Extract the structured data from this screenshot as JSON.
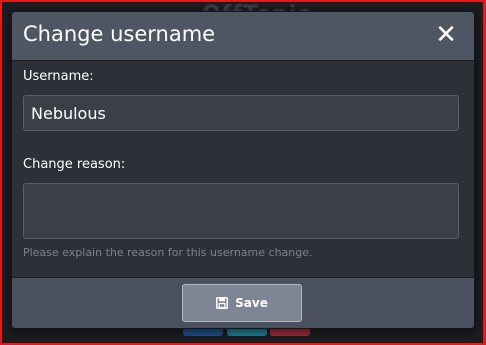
{
  "background": {
    "app_title": "OffTopic"
  },
  "modal": {
    "title": "Change username",
    "close_icon": "close-icon",
    "username": {
      "label": "Username:",
      "value": "Nebulous"
    },
    "reason": {
      "label": "Change reason:",
      "value": "",
      "help_text": "Please explain the reason for this username change."
    },
    "footer": {
      "save_label": "Save",
      "save_icon": "save-icon"
    }
  },
  "colors": {
    "header_bg": "#4e5563",
    "body_bg": "#2c3038",
    "footer_bg": "#4a505d",
    "button_bg": "#7e8595",
    "frame": "#e01b1b"
  }
}
